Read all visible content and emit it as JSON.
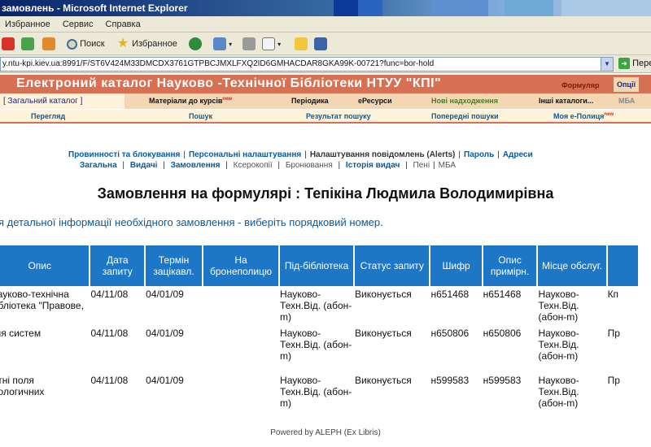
{
  "window": {
    "title": "замовлень - Microsoft Internet Explorer"
  },
  "menu": [
    "Избранное",
    "Сервис",
    "Справка"
  ],
  "toolbar": {
    "search_label": "Поиск",
    "favorites_label": "Избранное"
  },
  "address": {
    "url": "y.ntu-kpi.kiev.ua:8991/F/ST6V424M33DMCDX3761GTPBCJMXLFXQ2ID6GMHACDAR8GKA99K-00721?func=bor-hold",
    "go_label": "Переход"
  },
  "library": {
    "title": "Електроний каталог Науково -Технічної Бібліотеки НТУУ \"КПІ\"",
    "links": [
      "Формуляр",
      "Опції"
    ]
  },
  "nav1": {
    "home": "[ Загальний каталог ]",
    "items": [
      "Матеріали до курсів",
      "Періодика",
      "еРесурси",
      "Нові надходження",
      "Інші каталоги...",
      "МБА"
    ],
    "new_badge": "new"
  },
  "nav2": [
    "Перегляд",
    "Пошук",
    "Результат пошуку",
    "Попередні пошуки",
    "Моя е-Полиця"
  ],
  "account": {
    "row1": [
      "Провинності та блокування",
      "Персональні налаштування",
      "Налаштування повідомлень (Alerts)",
      "Пароль",
      "Адреси"
    ],
    "row2": [
      "Загальна",
      "Видачі",
      "Замовлення",
      "Ксерокопії",
      "Бронювання",
      "Історія видач",
      "Пені",
      "МБА"
    ]
  },
  "heading": "Замовлення на формулярі : Тепікіна Людмила Володимирівна",
  "instruction": "я детальної інформації необхідного замовлення - виберіть порядковий номер.",
  "table": {
    "headers": [
      "Опис",
      "Дата запиту",
      "Термін зацікавл.",
      "На бронеполицю",
      "Під-бібліотека",
      "Статус запиту",
      "Шифр",
      "Опис примірн.",
      "Місце обслуг.",
      ""
    ],
    "rows": [
      [
        "Науково-технічна бібліотека \"Правове,",
        "04/11/08",
        "04/01/09",
        "",
        "Науково-Техн.Від. (абон-m)",
        "Виконується",
        "н651468",
        "н651468",
        "Науково-Техн.Від. (абон-m)",
        "Кп"
      ],
      [
        "ння систем",
        "04/11/08",
        "04/01/09",
        "",
        "Науково-Техн.Від. (абон-m)",
        "Виконується",
        "н650806",
        "н650806",
        "Науково-Техн.Від. (абон-m)",
        "Пр"
      ],
      [
        "нітні поля біологичних",
        "04/11/08",
        "04/01/09",
        "",
        "Науково-Техн.Від. (абон-m)",
        "Виконується",
        "н599583",
        "н599583",
        "Науково-Техн.Від. (абон-m)",
        "Пр"
      ]
    ]
  },
  "footer": "Powered by ALEPH (Ex Libris)"
}
